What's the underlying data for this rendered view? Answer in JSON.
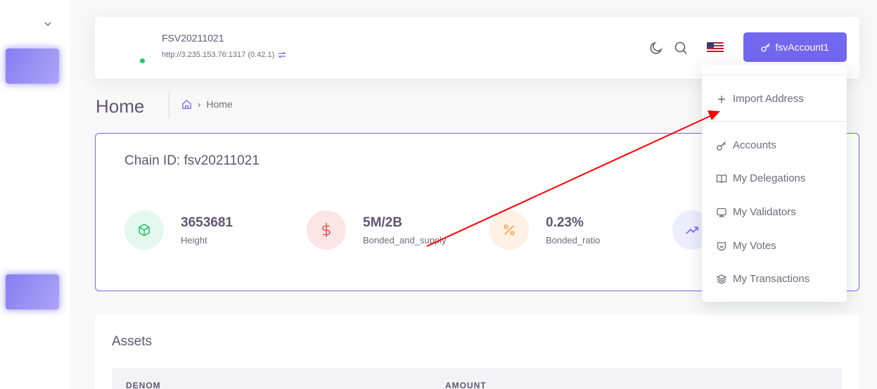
{
  "navbar": {
    "title": "FSV20211021",
    "url": "http://3.235.153.76:1317 (0.42.1)",
    "account_label": "fsvAccount1"
  },
  "page": {
    "title": "Home",
    "breadcrumb": "Home"
  },
  "stats": {
    "chain_id": "Chain ID: fsv20211021",
    "items": [
      {
        "value": "3653681",
        "label": "Height"
      },
      {
        "value": "5M/2B",
        "label": "Bonded_and_supply"
      },
      {
        "value": "0.23%",
        "label": "Bonded_ratio"
      }
    ]
  },
  "assets": {
    "title": "Assets",
    "columns": [
      "DENOM",
      "AMOUNT"
    ]
  },
  "dropdown": {
    "items": [
      {
        "label": "Import Address",
        "icon": "plus-icon"
      },
      {
        "label": "Accounts",
        "icon": "key-icon"
      },
      {
        "label": "My Delegations",
        "icon": "book-open-icon"
      },
      {
        "label": "My Validators",
        "icon": "monitor-icon"
      },
      {
        "label": "My Votes",
        "icon": "shield-check-icon"
      },
      {
        "label": "My Transactions",
        "icon": "layers-icon"
      }
    ]
  },
  "colors": {
    "primary": "#7367f0",
    "success": "#28c76f",
    "danger": "#ea5455",
    "warning": "#ff9f43",
    "annotation": "#ff0000"
  }
}
